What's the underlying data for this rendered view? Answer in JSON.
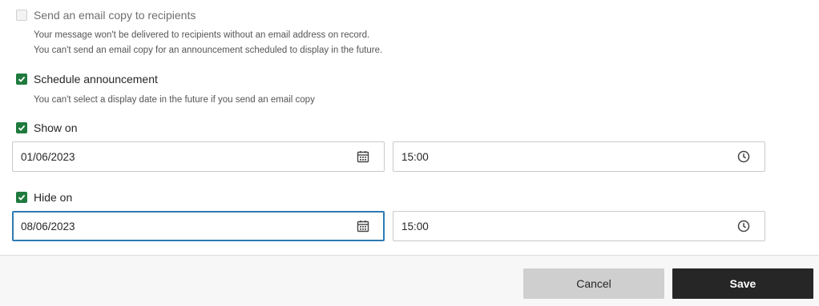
{
  "email_copy": {
    "label": "Send an email copy to recipients",
    "checked": false,
    "disabled": true,
    "help": [
      "Your message won't be delivered to recipients without an email address on record.",
      "You can't send an email copy for an announcement scheduled to display in the future."
    ]
  },
  "schedule": {
    "label": "Schedule announcement",
    "checked": true,
    "help": "You can't select a display date in the future if you send an email copy"
  },
  "show_on": {
    "label": "Show on",
    "checked": true,
    "date": "01/06/2023",
    "time": "15:00"
  },
  "hide_on": {
    "label": "Hide on",
    "checked": true,
    "date": "08/06/2023",
    "time": "15:00"
  },
  "icons": {
    "date": "calendar-icon",
    "time": "clock-icon",
    "check": "checkmark-icon"
  },
  "colors": {
    "checkbox": "#1f7a3d",
    "focus_border": "#2c7ab3",
    "save_bg": "#262626",
    "cancel_bg": "#cfcfcf"
  },
  "footer": {
    "cancel_label": "Cancel",
    "save_label": "Save"
  }
}
